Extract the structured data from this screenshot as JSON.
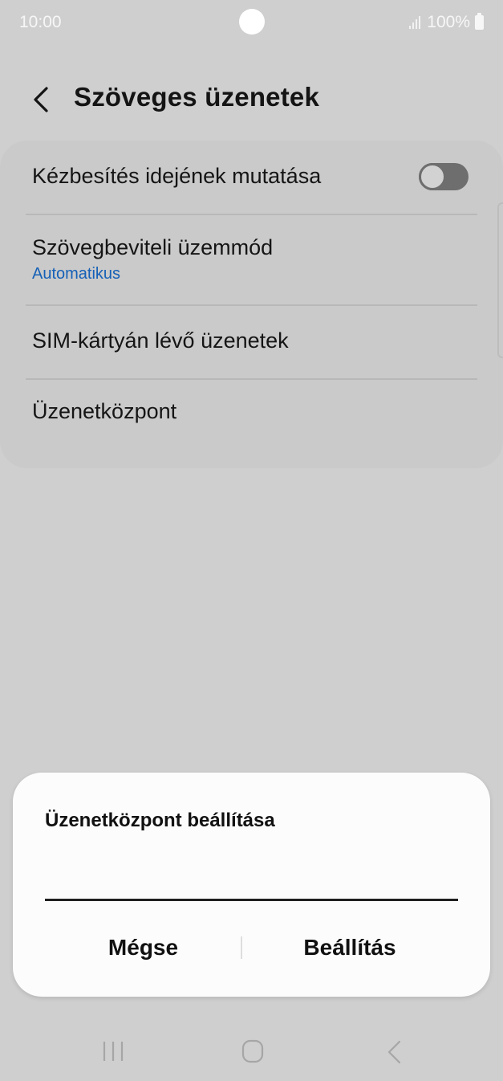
{
  "status_bar": {
    "time": "10:00",
    "battery": "100%",
    "signal_icon": "signal-icon",
    "battery_icon": "battery-icon"
  },
  "header": {
    "title": "Szöveges üzenetek",
    "back_icon": "chevron-left-icon"
  },
  "settings": {
    "delivery_time": {
      "label": "Kézbesítés idejének mutatása",
      "toggle_on": false
    },
    "input_mode": {
      "label": "Szövegbeviteli üzemmód",
      "value": "Automatikus"
    },
    "sim_messages": {
      "label": "SIM-kártyán lévő üzenetek"
    },
    "message_center": {
      "label": "Üzenetközpont"
    }
  },
  "dialog": {
    "title": "Üzenetközpont beállítása",
    "input_value": "",
    "cancel_label": "Mégse",
    "confirm_label": "Beállítás"
  },
  "nav_bar": {
    "recents_icon": "recents-icon",
    "home_icon": "home-icon",
    "back_icon": "back-icon"
  },
  "colors": {
    "background": "#cfcfcf",
    "accent_link": "#1560b7",
    "dialog_bg": "#fcfcfc",
    "toggle_off": "#6e6e6e"
  }
}
